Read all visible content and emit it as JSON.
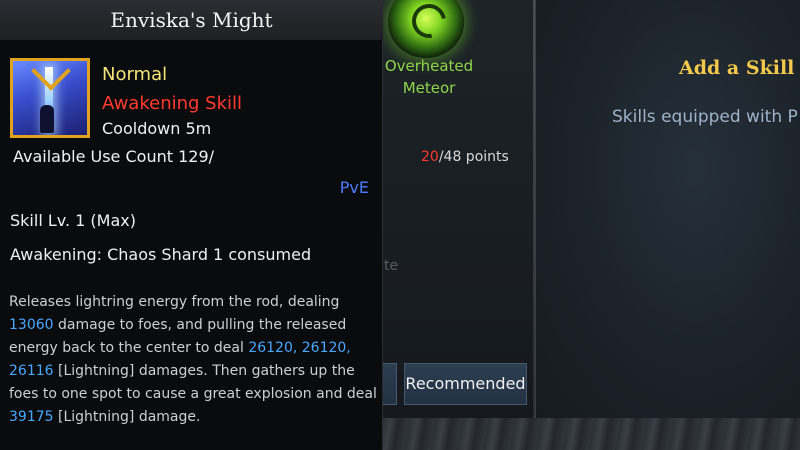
{
  "tooltip": {
    "title": "Enviska's Might",
    "icon": "awakening-skill-icon",
    "grade": "Normal",
    "skill_type": "Awakening Skill",
    "cooldown": "Cooldown 5m",
    "use_count": "Available Use Count 129/",
    "mode": "PvE",
    "skill_level": "Skill Lv. 1 (Max)",
    "awakening_cost": "Awakening: Chaos Shard 1 consumed",
    "description": [
      {
        "t": "Releases lightring energy from the rod, dealing "
      },
      {
        "t": "13060",
        "hl": true
      },
      {
        "t": " damage to foes, and pulling the released energy back to the center to deal "
      },
      {
        "t": "26120, 26120, 26116",
        "hl": true
      },
      {
        "t": " [Lightning] damages. Then gathers up the foes to one spot to cause a great explosion and deal "
      },
      {
        "t": "39175",
        "hl": true
      },
      {
        "t": " [Lightning] damage."
      }
    ]
  },
  "background": {
    "skill_label": "Overheated\nMeteor",
    "points_used": "20",
    "points_total": "/48 points",
    "faint_text": "te",
    "recommended_button": "Recommended",
    "add_skill_title": "Add a Skill P",
    "skills_equipped": "Skills equipped with P"
  },
  "colors": {
    "grade": "#f3e57a",
    "skill_type": "#ff3b30",
    "mode": "#4d7dff",
    "highlight_number": "#4aa8ff",
    "gold_title": "#f2c94c"
  }
}
